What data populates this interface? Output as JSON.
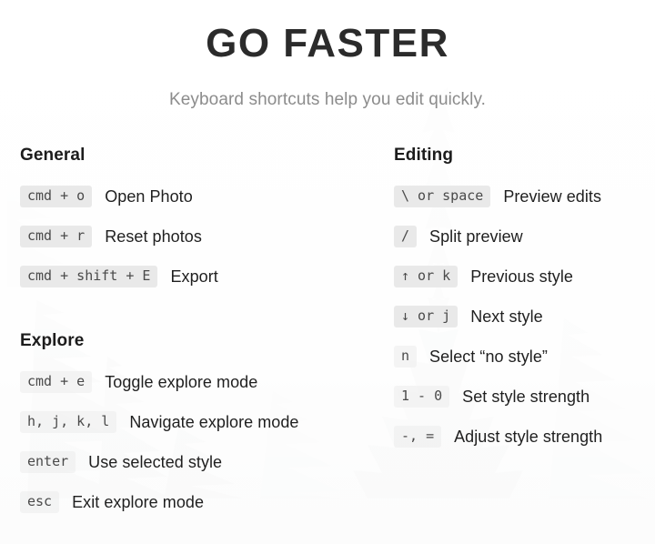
{
  "header": {
    "title": "GO FASTER",
    "subtitle": "Keyboard shortcuts help you edit quickly."
  },
  "colors": {
    "page_background": "#fbfbfb",
    "page_background_bottom": "#ecedee",
    "title_text": "#2b2b2b",
    "subtitle_text": "#8c8c8c",
    "heading_text": "#1c1c1c",
    "action_text": "#1f1f1f",
    "key_badge_background": "#e9e9e9",
    "key_badge_text": "#4a4a4a"
  },
  "columns": {
    "left": [
      {
        "heading": "General",
        "shortcuts": [
          {
            "keys": "cmd + o",
            "action": "Open Photo",
            "faint": false
          },
          {
            "keys": "cmd + r",
            "action": "Reset photos",
            "faint": false
          },
          {
            "keys": "cmd + shift + E",
            "action": "Export",
            "faint": false
          }
        ]
      },
      {
        "heading": "Explore",
        "shortcuts": [
          {
            "keys": "cmd + e",
            "action": "Toggle explore mode",
            "faint": true
          },
          {
            "keys": "h, j, k, l",
            "action": "Navigate explore mode",
            "faint": true
          },
          {
            "keys": "enter",
            "action": "Use selected style",
            "faint": true
          },
          {
            "keys": "esc",
            "action": "Exit explore mode",
            "faint": true
          }
        ]
      }
    ],
    "right": [
      {
        "heading": "Editing",
        "shortcuts": [
          {
            "keys": "\\ or space",
            "action": "Preview edits",
            "faint": false
          },
          {
            "keys": "/",
            "action": "Split preview",
            "faint": false
          },
          {
            "keys": "↑ or k",
            "action": "Previous style",
            "faint": false
          },
          {
            "keys": "↓ or j",
            "action": "Next style",
            "faint": false
          },
          {
            "keys": "n",
            "action": "Select “no style”",
            "faint": true
          },
          {
            "keys": "1 - 0",
            "action": "Set style strength",
            "faint": true
          },
          {
            "keys": "-, =",
            "action": "Adjust style strength",
            "faint": true
          }
        ]
      }
    ]
  }
}
